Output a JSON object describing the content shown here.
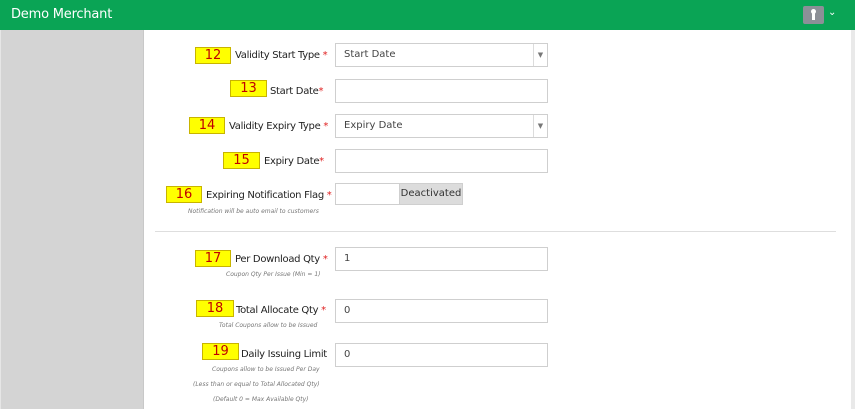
{
  "header": {
    "title": "Demo Merchant",
    "accent_color": "#0aa455",
    "user_icon": "key-icon",
    "menu_icon": "chevron-down-icon",
    "chevron": "⌄"
  },
  "form": {
    "validity_start_type": {
      "tag": "12",
      "label": "Validity Start Type",
      "required": "*",
      "value": "Start Date",
      "arrow": "▼"
    },
    "start_date": {
      "tag": "13",
      "label": "Start Date",
      "required": "*",
      "value": ""
    },
    "validity_expiry_type": {
      "tag": "14",
      "label": "Validity Expiry Type",
      "required": "*",
      "value": "Expiry Date",
      "arrow": "▼"
    },
    "expiry_date": {
      "tag": "15",
      "label": "Expiry Date",
      "required": "*",
      "value": ""
    },
    "expiring_notification_flag": {
      "tag": "16",
      "label": "Expiring Notification Flag",
      "required": "*",
      "hint": "Notification will be auto email to customers",
      "state": "Deactivated"
    },
    "per_download_qty": {
      "tag": "17",
      "label": "Per Download Qty",
      "required": "*",
      "hint": "Coupon Qty Per Issue (Min = 1)",
      "value": "1"
    },
    "total_allocate_qty": {
      "tag": "18",
      "label": "Total Allocate Qty",
      "required": "*",
      "hint": "Total Coupons allow to be Issued",
      "value": "0"
    },
    "daily_issuing_limit": {
      "tag": "19",
      "label": "Daily Issuing Limit",
      "hint1": "Coupons allow to be Issued Per Day",
      "hint2": "(Less than or equal to Total Allocated Qty)",
      "hint3": "(Default 0 = Max Available Qty)",
      "value": "0"
    }
  }
}
